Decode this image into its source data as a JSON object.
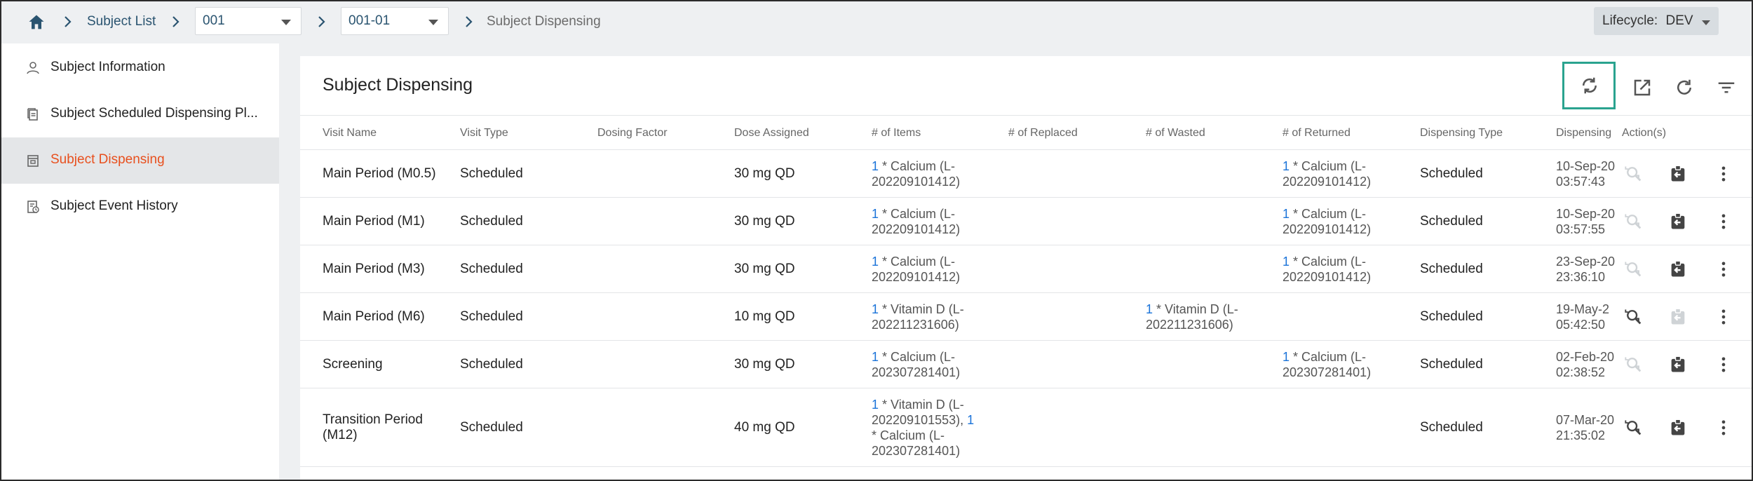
{
  "breadcrumb": {
    "home": "home-icon",
    "subject_list": "Subject List",
    "site_select": "001",
    "subject_select": "001-01",
    "current": "Subject Dispensing"
  },
  "lifecycle": {
    "label": "Lifecycle:",
    "value": "DEV"
  },
  "sidebar": {
    "items": [
      {
        "label": "Subject Information",
        "icon": "person-icon"
      },
      {
        "label": "Subject Scheduled Dispensing Pl...",
        "icon": "document-icon"
      },
      {
        "label": "Subject Dispensing",
        "icon": "dispensing-icon"
      },
      {
        "label": "Subject Event History",
        "icon": "history-icon"
      }
    ]
  },
  "main": {
    "title": "Subject Dispensing",
    "toolbar": [
      "sync-icon",
      "open-external-icon",
      "refresh-icon",
      "filter-icon"
    ]
  },
  "table": {
    "columns": [
      "Visit Name",
      "Visit Type",
      "Dosing Factor",
      "Dose Assigned",
      "# of Items",
      "# of Replaced",
      "# of Wasted",
      "# of Returned",
      "Dispensing Type",
      "Dispensing",
      "Action(s)"
    ],
    "rows": [
      {
        "visit_name": "Main Period (M0.5)",
        "visit_name_2": "",
        "visit_type": "Scheduled",
        "dose": "30 mg QD",
        "items": [
          [
            "1",
            " * Calcium (L-"
          ],
          [
            "",
            "202209101412)"
          ]
        ],
        "wasted": [],
        "returned": [
          [
            "1",
            " * Calcium (L-"
          ],
          [
            "",
            "202209101412)"
          ]
        ],
        "dispensing_type": "Scheduled",
        "date": "10-Sep-20",
        "time": "03:57:43",
        "reopen_enabled": false,
        "return_enabled": true
      },
      {
        "visit_name": "Main Period (M1)",
        "visit_name_2": "",
        "visit_type": "Scheduled",
        "dose": "30 mg QD",
        "items": [
          [
            "1",
            " * Calcium (L-"
          ],
          [
            "",
            "202209101412)"
          ]
        ],
        "wasted": [],
        "returned": [
          [
            "1",
            " * Calcium (L-"
          ],
          [
            "",
            "202209101412)"
          ]
        ],
        "dispensing_type": "Scheduled",
        "date": "10-Sep-20",
        "time": "03:57:55",
        "reopen_enabled": false,
        "return_enabled": true
      },
      {
        "visit_name": "Main Period (M3)",
        "visit_name_2": "",
        "visit_type": "Scheduled",
        "dose": "30 mg QD",
        "items": [
          [
            "1",
            " * Calcium (L-"
          ],
          [
            "",
            "202209101412)"
          ]
        ],
        "wasted": [],
        "returned": [
          [
            "1",
            " * Calcium (L-"
          ],
          [
            "",
            "202209101412)"
          ]
        ],
        "dispensing_type": "Scheduled",
        "date": "23-Sep-20",
        "time": "23:36:10",
        "reopen_enabled": false,
        "return_enabled": true
      },
      {
        "visit_name": "Main Period (M6)",
        "visit_name_2": "",
        "visit_type": "Scheduled",
        "dose": "10 mg QD",
        "items": [
          [
            "1",
            " * Vitamin D (L-"
          ],
          [
            "",
            "202211231606)"
          ]
        ],
        "wasted": [
          [
            "1",
            " * Vitamin D (L-"
          ],
          [
            "",
            "202211231606)"
          ]
        ],
        "returned": [],
        "dispensing_type": "Scheduled",
        "date": "19-May-2",
        "time": "05:42:50",
        "reopen_enabled": true,
        "return_enabled": false
      },
      {
        "visit_name": "Screening",
        "visit_name_2": "",
        "visit_type": "Scheduled",
        "dose": "30 mg QD",
        "items": [
          [
            "1",
            " * Calcium (L-"
          ],
          [
            "",
            "202307281401)"
          ]
        ],
        "wasted": [],
        "returned": [
          [
            "1",
            " * Calcium (L-"
          ],
          [
            "",
            "202307281401)"
          ]
        ],
        "dispensing_type": "Scheduled",
        "date": "02-Feb-20",
        "time": "02:38:52",
        "reopen_enabled": false,
        "return_enabled": true
      },
      {
        "visit_name": "Transition Period",
        "visit_name_2": "(M12)",
        "visit_type": "Scheduled",
        "dose": "40 mg QD",
        "items": [
          [
            "1",
            " * Vitamin D (L-"
          ],
          [
            "",
            "202209101553), ",
            "1"
          ],
          [
            "",
            "* Calcium (L-"
          ],
          [
            "",
            "202307281401)"
          ]
        ],
        "wasted": [],
        "returned": [],
        "dispensing_type": "Scheduled",
        "date": "07-Mar-20",
        "time": "21:35:02",
        "reopen_enabled": true,
        "return_enabled": true
      }
    ]
  },
  "colors": {
    "accent_active": "#e8501e",
    "link_number": "#1a73d9",
    "highlight_box": "#2aa38f",
    "breadcrumb_text": "#2a5470"
  }
}
